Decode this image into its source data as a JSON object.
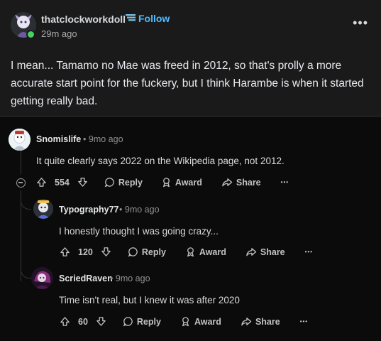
{
  "post": {
    "username": "thatclockworkdoll",
    "follow_label": "Follow",
    "time": "29m ago",
    "more_label": "•••",
    "body": "I mean... Tamamo no Mae was freed in 2012, so that's prolly a more accurate start point for the fuckery, but I think Harambe is when it started getting really bad."
  },
  "comments": [
    {
      "username": "Snomislife",
      "time": "9mo ago",
      "text": "It quite clearly says 2022 on the Wikipedia page, not 2012.",
      "votes": "554",
      "reply_label": "Reply",
      "award_label": "Award",
      "share_label": "Share",
      "more_label": "•••"
    },
    {
      "username": "Typography77",
      "time": "9mo ago",
      "text": "I honestly thought I was going crazy...",
      "votes": "120",
      "reply_label": "Reply",
      "award_label": "Award",
      "share_label": "Share",
      "more_label": "•••"
    },
    {
      "username": "ScriedRaven",
      "time": "9mo ago",
      "text": "Time isn't real, but I knew it was after 2020",
      "votes": "60",
      "reply_label": "Reply",
      "award_label": "Award",
      "share_label": "Share",
      "more_label": "•••"
    }
  ],
  "separator": "•",
  "colors": {
    "background": "#0b0b0b",
    "post_background": "#1a1a1b",
    "follow_blue": "#4fbcff",
    "online_green": "#46d160",
    "thread_line": "#343536"
  },
  "icons": [
    "flair-icon",
    "upvote-icon",
    "downvote-icon",
    "reply-bubble-icon",
    "award-icon",
    "share-arrow-icon",
    "collapse-icon",
    "more-icon"
  ]
}
